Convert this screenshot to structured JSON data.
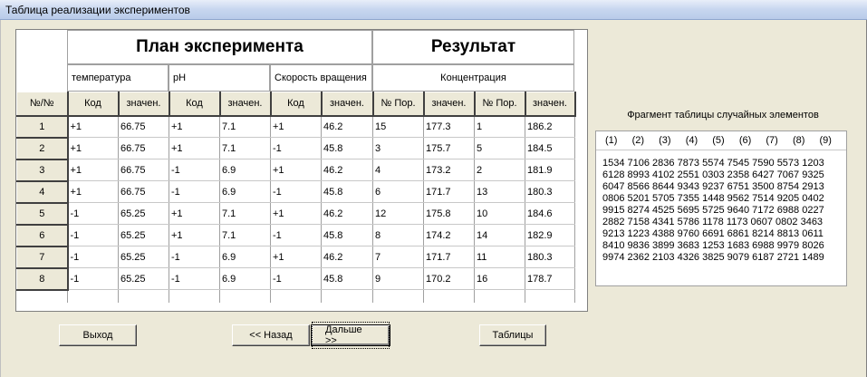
{
  "window": {
    "title": "Таблица реализации экспериментов"
  },
  "plan": {
    "title": "План эксперимента",
    "factors": [
      "температура",
      "pH",
      "Скорость вращения"
    ]
  },
  "result": {
    "title": "Результат",
    "measure": "Концентрация"
  },
  "table": {
    "columns": [
      "№/№",
      "Код",
      "значен.",
      "Код",
      "значен.",
      "Код",
      "значен.",
      "№ Пор.",
      "значен.",
      "№ Пор.",
      "значен."
    ],
    "rows": [
      [
        "1",
        "+1",
        "66.75",
        "+1",
        "7.1",
        "+1",
        "46.2",
        "15",
        "177.3",
        "1",
        "186.2"
      ],
      [
        "2",
        "+1",
        "66.75",
        "+1",
        "7.1",
        "-1",
        "45.8",
        "3",
        "175.7",
        "5",
        "184.5"
      ],
      [
        "3",
        "+1",
        "66.75",
        "-1",
        "6.9",
        "+1",
        "46.2",
        "4",
        "173.2",
        "2",
        "181.9"
      ],
      [
        "4",
        "+1",
        "66.75",
        "-1",
        "6.9",
        "-1",
        "45.8",
        "6",
        "171.7",
        "13",
        "180.3"
      ],
      [
        "5",
        "-1",
        "65.25",
        "+1",
        "7.1",
        "+1",
        "46.2",
        "12",
        "175.8",
        "10",
        "184.6"
      ],
      [
        "6",
        "-1",
        "65.25",
        "+1",
        "7.1",
        "-1",
        "45.8",
        "8",
        "174.2",
        "14",
        "182.9"
      ],
      [
        "7",
        "-1",
        "65.25",
        "-1",
        "6.9",
        "+1",
        "46.2",
        "7",
        "171.7",
        "11",
        "180.3"
      ],
      [
        "8",
        "-1",
        "65.25",
        "-1",
        "6.9",
        "-1",
        "45.8",
        "9",
        "170.2",
        "16",
        "178.7"
      ]
    ]
  },
  "random_table": {
    "caption": "Фрагмент таблицы случайных элементов",
    "headers": [
      "(1)",
      "(2)",
      "(3)",
      "(4)",
      "(5)",
      "(6)",
      "(7)",
      "(8)",
      "(9)"
    ],
    "rows": [
      "1534 7106 2836 7873 5574 7545 7590 5573 1203",
      "6128 8993 4102 2551 0303 2358 6427 7067 9325",
      "6047 8566 8644 9343 9237 6751 3500 8754 2913",
      "0806 5201 5705 7355 1448 9562 7514 9205 0402",
      "9915 8274 4525 5695 5725 9640 7172 6988 0227",
      "2882 7158 4341 5786 1178 1173 0607 0802 3463",
      "9213 1223 4388 9760 6691 6861 8214 8813 0611",
      "8410 9836 3899 3683 1253 1683 6988 9979 8026",
      "9974 2362 2103 4326 3825 9079 6187 2721 1489"
    ]
  },
  "buttons": {
    "exit": "Выход",
    "back": "<< Назад",
    "next": "Дальше >>",
    "tables": "Таблицы"
  }
}
